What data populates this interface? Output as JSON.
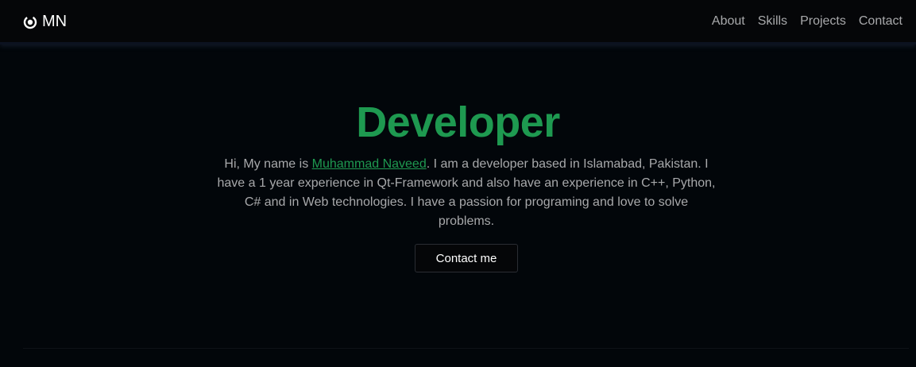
{
  "navbar": {
    "brand": "MN",
    "links": [
      "About",
      "Skills",
      "Projects",
      "Contact"
    ]
  },
  "hero": {
    "title": "Developer",
    "intro_before": "Hi, My name is ",
    "name": "Muhammad Naveed",
    "intro_after": ". I am a developer based in Islamabad, Pakistan. I have a 1 year experience in Qt-Framework and also have an experience in C++, Python, C# and in Web technologies. I have a passion for programing and love to solve problems.",
    "button_label": "Contact me"
  },
  "colors": {
    "accent": "#1e9950",
    "background": "#02060a",
    "navbar": "#050608",
    "muted_text": "#a8a9ab"
  },
  "icons": {
    "brand": "circle-dot-icon"
  }
}
